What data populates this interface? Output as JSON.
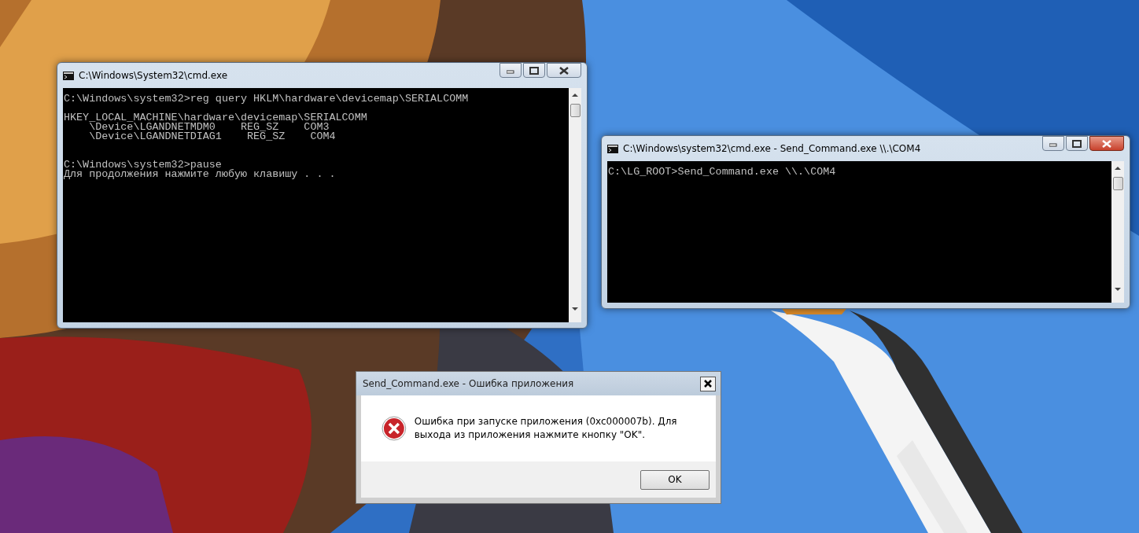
{
  "windows": [
    {
      "kind": "console",
      "title": "C:\\Windows\\System32\\cmd.exe",
      "focused": false,
      "lines": [
        {
          "kind": "text",
          "text": "C:\\Windows\\system32>reg query HKLM\\hardware\\devicemap\\SERIALCOMM"
        },
        {
          "kind": "blank"
        },
        {
          "kind": "text",
          "text": "HKEY_LOCAL_MACHINE\\hardware\\devicemap\\SERIALCOMM"
        },
        {
          "kind": "text",
          "text": "    \\Device\\LGANDNETMDM0    REG_SZ    COM3"
        },
        {
          "kind": "text",
          "text": "    \\Device\\LGANDNETDIAG1    REG_SZ    COM4"
        },
        {
          "kind": "blank"
        },
        {
          "kind": "blank"
        },
        {
          "kind": "text",
          "text": "C:\\Windows\\system32>pause"
        },
        {
          "kind": "text",
          "text": "Для продолжения нажмите любую клавишу . . ."
        }
      ]
    },
    {
      "kind": "console",
      "title": "C:\\Windows\\system32\\cmd.exe - Send_Command.exe  \\\\.\\COM4",
      "focused": true,
      "lines": [
        {
          "kind": "text",
          "text": "C:\\LG_ROOT>Send_Command.exe \\\\.\\COM4"
        }
      ]
    },
    {
      "kind": "dialog",
      "title": "Send_Command.exe - Ошибка приложения",
      "message": "Ошибка при запуске приложения (0xc000007b). Для выхода из приложения нажмите кнопку \"OK\".",
      "buttons": [
        "OK"
      ]
    }
  ]
}
